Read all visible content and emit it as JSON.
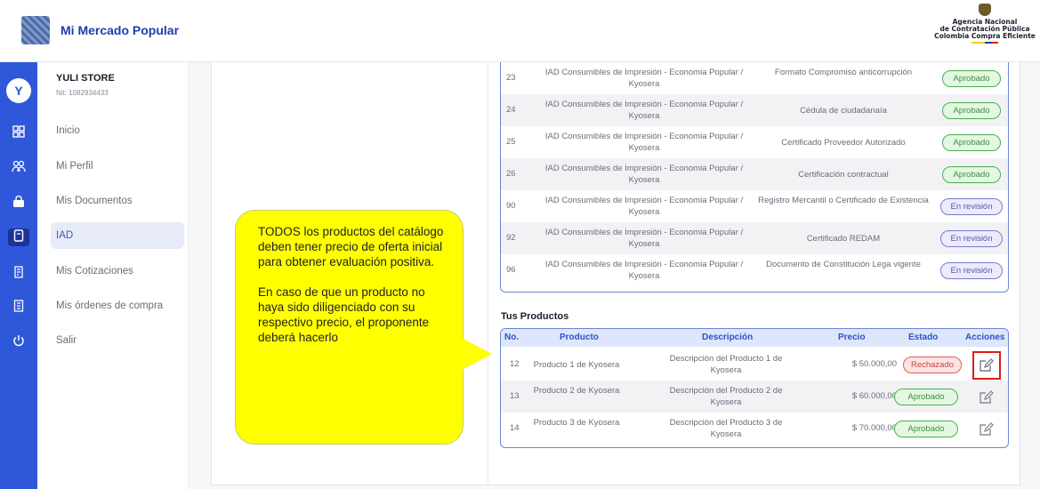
{
  "header": {
    "app_title": "Mi Mercado Popular",
    "agency_line1": "Agencia Nacional",
    "agency_line2": "de Contratación Pública",
    "agency_line3": "Colombia Compra Eficiente"
  },
  "rail": {
    "avatar_letter": "Y",
    "icons": [
      "grid-icon",
      "users-icon",
      "bag-icon",
      "document-icon",
      "quote-icon",
      "orders-icon",
      "power-icon"
    ]
  },
  "sidebar": {
    "store_name": "YULI STORE",
    "store_nit": "Nit: 1082934433",
    "items": [
      {
        "label": "Inicio"
      },
      {
        "label": "Mi Perfil"
      },
      {
        "label": "Mis Documentos"
      },
      {
        "label": "IAD"
      },
      {
        "label": "Mis Cotizaciones"
      },
      {
        "label": "Mis órdenes de compra"
      },
      {
        "label": "Salir"
      }
    ],
    "active_item": "IAD"
  },
  "documents": {
    "rows": [
      {
        "num": "23",
        "iad": "IAD Consumibles de Impresión - Economia Popular / Kyosera",
        "document": "Formato Compromiso anticorrupción",
        "status": "Aprobado"
      },
      {
        "num": "24",
        "iad": "IAD Consumibles de Impresión - Economia Popular / Kyosera",
        "document": "Cédula de ciudadanaía",
        "status": "Aprobado"
      },
      {
        "num": "25",
        "iad": "IAD Consumibles de Impresión - Economia Popular / Kyosera",
        "document": "Certificado Proveedor Autorizado",
        "status": "Aprobado"
      },
      {
        "num": "26",
        "iad": "IAD Consumibles de Impresión - Economia Popular / Kyosera",
        "document": "Certificación contractual",
        "status": "Aprobado"
      },
      {
        "num": "90",
        "iad": "IAD Consumibles de Impresión - Economia Popular / Kyosera",
        "document": "Registro Mercantil o Certificado de Existencia",
        "status": "En revisión"
      },
      {
        "num": "92",
        "iad": "IAD Consumibles de Impresión - Economia Popular / Kyosera",
        "document": "Certificado REDAM",
        "status": "En revisión"
      },
      {
        "num": "96",
        "iad": "IAD Consumibles de Impresión - Economia Popular / Kyosera",
        "document": "Documento de Constitución Lega vigente",
        "status": "En revisión"
      }
    ]
  },
  "products": {
    "title": "Tus Productos",
    "headers": {
      "no": "No.",
      "product": "Producto",
      "description": "Descripción",
      "price": "Precio",
      "status": "Estado",
      "actions": "Acciones"
    },
    "rows": [
      {
        "no": "12",
        "name": "Producto 1 de Kyosera",
        "description": "Descripción del Producto 1 de Kyosera",
        "price": "$ 50.000,00",
        "status": "Rechazado"
      },
      {
        "no": "13",
        "name": "Producto 2 de Kyosera",
        "description": "Descripción del Producto 2 de Kyosera",
        "price": "$ 60.000,00",
        "status": "Aprobado"
      },
      {
        "no": "14",
        "name": "Producto 3 de Kyosera",
        "description": "Descripción del Producto 3 de Kyosera",
        "price": "$ 70.000,00",
        "status": "Aprobado"
      }
    ]
  },
  "callout": {
    "paragraph1": "TODOS los productos del catálogo deben tener precio de oferta inicial para obtener evaluación positiva.",
    "paragraph2": "En caso de que un producto no haya sido diligenciado con su respectivo precio, el proponente deberá hacerlo"
  },
  "colors": {
    "brand": "#2f57d9",
    "approved": "#45b04a",
    "review": "#7a78d2",
    "rejected": "#e05d55",
    "callout": "#ffff00"
  }
}
